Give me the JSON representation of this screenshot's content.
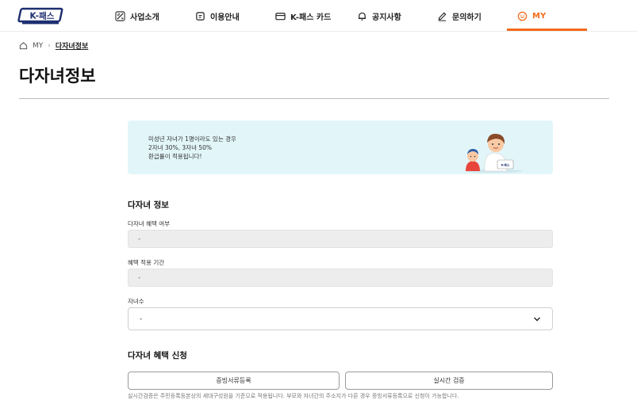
{
  "header": {
    "logo_text": "K-패스",
    "nav": [
      {
        "label": "사업소개",
        "icon": "sparkle-icon"
      },
      {
        "label": "이용안내",
        "icon": "guide-icon"
      },
      {
        "label": "K-패스 카드",
        "icon": "card-icon"
      },
      {
        "label": "공지사항",
        "icon": "bell-icon"
      },
      {
        "label": "문의하기",
        "icon": "pencil-icon"
      },
      {
        "label": "MY",
        "icon": "smile-icon",
        "active": true
      }
    ],
    "accent_color": "#f26b1d"
  },
  "breadcrumb": {
    "root": "MY",
    "current": "다자녀정보"
  },
  "page_title": "다자녀정보",
  "banner": {
    "lines": [
      "미성년 자녀가 1명이라도 있는 경우",
      "2자녀 30%, 3자녀 50%",
      "환급률이 적용됩니다!"
    ],
    "card_text": "K-패스",
    "background": "#e2f6fa"
  },
  "info_section": {
    "title": "다자녀 정보",
    "benefit_label": "다자녀 혜택 여부",
    "benefit_value": "-",
    "period_label": "혜택 적용 기간",
    "period_value": "-",
    "children_label": "자녀수",
    "children_value": "-"
  },
  "apply_section": {
    "title": "다자녀 혜택 신청",
    "doc_button": "증빙서류등록",
    "verify_button": "실시간 검증",
    "note": "실시간검증은 주민등록등본상의 세대구성원을 기준으로 적용됩니다. 부모와 자녀간의 주소지가 다른 경우 증빙서류등록으로 신청이 가능합니다."
  }
}
